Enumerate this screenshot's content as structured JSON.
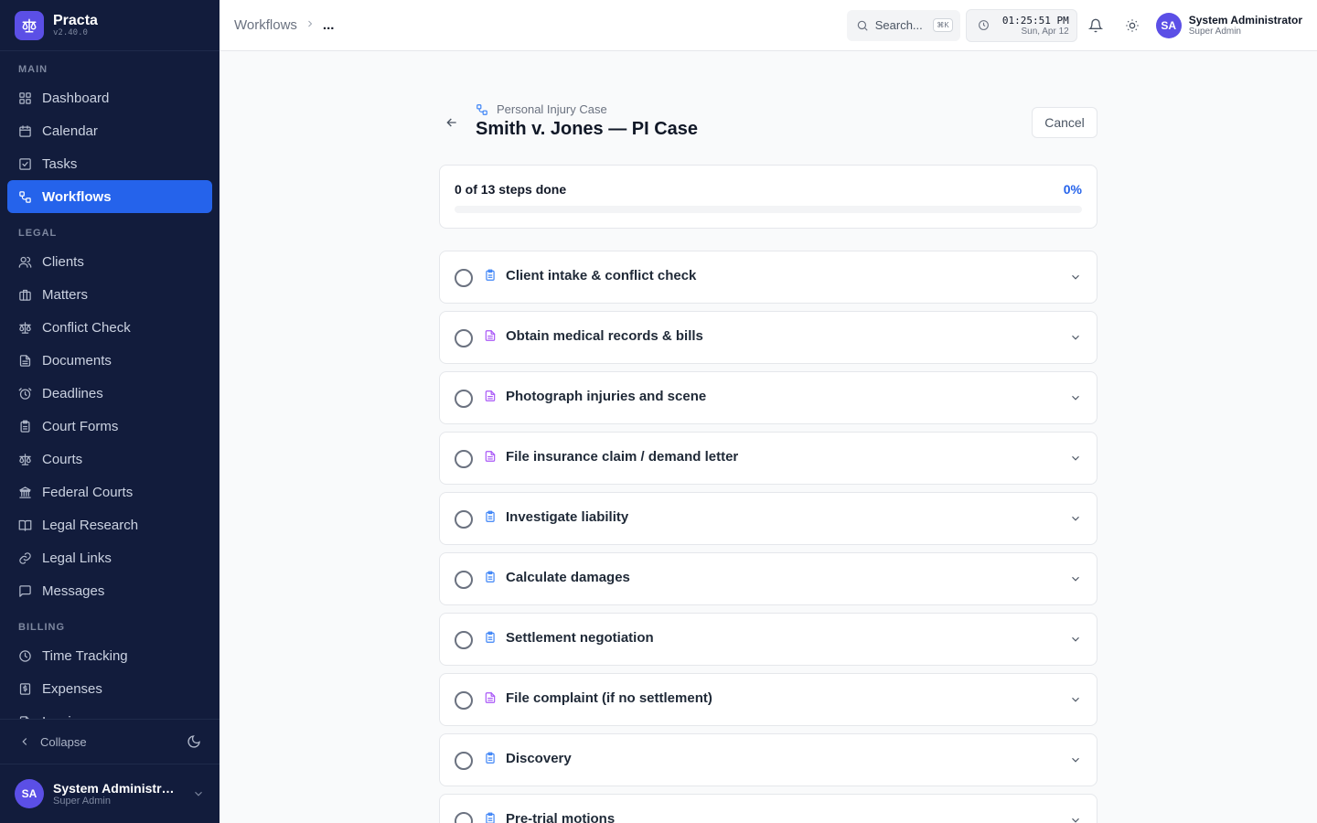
{
  "app": {
    "name": "Practa",
    "version": "v2.40.0"
  },
  "sidebar": {
    "sections": [
      {
        "label": "MAIN",
        "items": [
          {
            "label": "Dashboard",
            "icon": "dashboard-icon",
            "active": false
          },
          {
            "label": "Calendar",
            "icon": "calendar-icon",
            "active": false
          },
          {
            "label": "Tasks",
            "icon": "tasks-icon",
            "active": false
          },
          {
            "label": "Workflows",
            "icon": "workflow-icon",
            "active": true
          }
        ]
      },
      {
        "label": "LEGAL",
        "items": [
          {
            "label": "Clients",
            "icon": "users-icon",
            "active": false
          },
          {
            "label": "Matters",
            "icon": "briefcase-icon",
            "active": false
          },
          {
            "label": "Conflict Check",
            "icon": "scale-icon",
            "active": false
          },
          {
            "label": "Documents",
            "icon": "document-icon",
            "active": false
          },
          {
            "label": "Deadlines",
            "icon": "alarm-icon",
            "active": false
          },
          {
            "label": "Court Forms",
            "icon": "clipboard-icon",
            "active": false
          },
          {
            "label": "Courts",
            "icon": "scale-icon",
            "active": false
          },
          {
            "label": "Federal Courts",
            "icon": "landmark-icon",
            "active": false
          },
          {
            "label": "Legal Research",
            "icon": "book-icon",
            "active": false
          },
          {
            "label": "Legal Links",
            "icon": "link-icon",
            "active": false
          },
          {
            "label": "Messages",
            "icon": "message-icon",
            "active": false
          }
        ]
      },
      {
        "label": "BILLING",
        "items": [
          {
            "label": "Time Tracking",
            "icon": "clock-icon",
            "active": false
          },
          {
            "label": "Expenses",
            "icon": "receipt-icon",
            "active": false
          },
          {
            "label": "Invoices",
            "icon": "invoice-icon",
            "active": false
          }
        ]
      }
    ],
    "collapse_label": "Collapse",
    "user": {
      "initials": "SA",
      "name": "System Administrator",
      "role": "Super Admin"
    }
  },
  "topbar": {
    "breadcrumb": [
      "Workflows",
      "..."
    ],
    "search_placeholder": "Search...",
    "search_shortcut": "⌘K",
    "clock_time": "01:25:51 PM",
    "clock_date": "Sun, Apr 12",
    "user": {
      "initials": "SA",
      "name": "System Administrator",
      "role": "Super Admin"
    }
  },
  "page": {
    "type_label": "Personal Injury Case",
    "title": "Smith v. Jones — PI Case",
    "cancel_label": "Cancel"
  },
  "progress": {
    "label": "0 of 13 steps done",
    "percent_label": "0%",
    "fraction": 0
  },
  "steps": [
    {
      "label": "Client intake & conflict check",
      "icon": "clipboard-icon",
      "color": "#3b82f6"
    },
    {
      "label": "Obtain medical records & bills",
      "icon": "document-icon",
      "color": "#a855f7"
    },
    {
      "label": "Photograph injuries and scene",
      "icon": "document-icon",
      "color": "#a855f7"
    },
    {
      "label": "File insurance claim / demand letter",
      "icon": "document-icon",
      "color": "#a855f7"
    },
    {
      "label": "Investigate liability",
      "icon": "clipboard-icon",
      "color": "#3b82f6"
    },
    {
      "label": "Calculate damages",
      "icon": "clipboard-icon",
      "color": "#3b82f6"
    },
    {
      "label": "Settlement negotiation",
      "icon": "clipboard-icon",
      "color": "#3b82f6"
    },
    {
      "label": "File complaint (if no settlement)",
      "icon": "document-icon",
      "color": "#a855f7"
    },
    {
      "label": "Discovery",
      "icon": "clipboard-icon",
      "color": "#3b82f6"
    },
    {
      "label": "Pre-trial motions",
      "icon": "clipboard-icon",
      "color": "#3b82f6"
    }
  ],
  "colors": {
    "sidebar_bg": "#121c3c",
    "accent": "#2563eb",
    "brand": "#5b4fe6"
  }
}
